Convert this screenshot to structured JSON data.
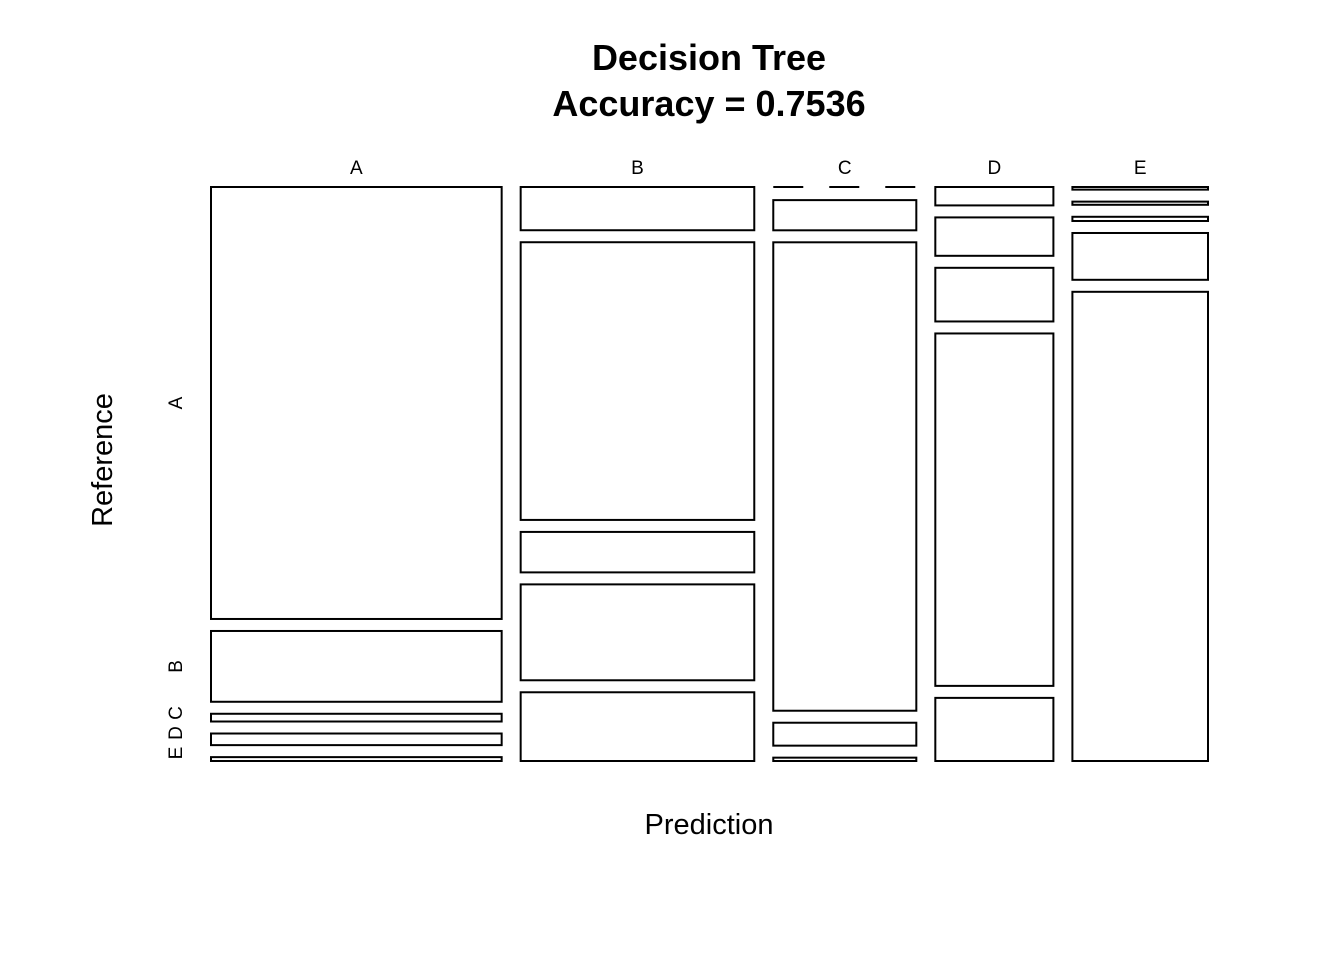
{
  "chart_data": {
    "type": "mosaic",
    "title": "Decision Tree",
    "subtitle": "Accuracy = 0.7536",
    "xlabel": "Prediction",
    "ylabel": "Reference",
    "columns": [
      "A",
      "B",
      "C",
      "D",
      "E"
    ],
    "rows": [
      "A",
      "B",
      "C",
      "D",
      "E"
    ],
    "column_shares": [
      0.2853,
      0.2293,
      0.1404,
      0.1159,
      0.1331
    ],
    "row_proportions": {
      "A": [
        0.781,
        0.128,
        0.014,
        0.021,
        0.007
      ],
      "B": [
        0.078,
        0.501,
        0.073,
        0.173,
        0.124
      ],
      "C": [
        0.002,
        0.054,
        0.838,
        0.041,
        0.006
      ],
      "D": [
        0.035,
        0.073,
        0.102,
        0.67,
        0.12
      ],
      "E": [
        0.005,
        0.006,
        0.008,
        0.089,
        0.892
      ]
    }
  }
}
